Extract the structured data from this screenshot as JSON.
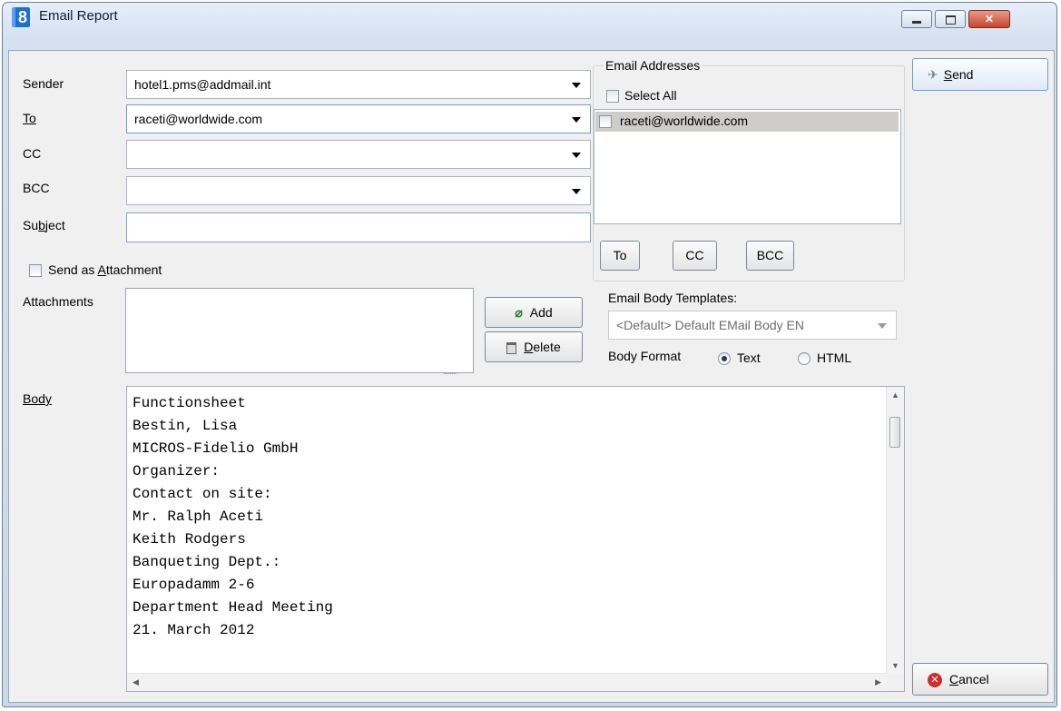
{
  "window": {
    "title": "Email Report",
    "app_icon": "8"
  },
  "form": {
    "sender_label": "Sender",
    "sender_value": "hotel1.pms@addmail.int",
    "to_label": "To",
    "to_value": "raceti@worldwide.com",
    "cc_label": "CC",
    "cc_value": "",
    "bcc_label": "BCC",
    "bcc_value": "",
    "subject_label_pre": "Su",
    "subject_label_u": "b",
    "subject_label_post": "ject",
    "subject_value": "",
    "send_as_attachment_pre": "Send as ",
    "send_as_attachment_u": "A",
    "send_as_attachment_post": "ttachment",
    "attachments_label": "Attachments",
    "add_label": "Add",
    "delete_label_u": "D",
    "delete_label_post": "elete",
    "body_label": "Body"
  },
  "email_addresses": {
    "group_label": "Email Addresses",
    "select_all_label": "Select All",
    "items": [
      {
        "label": "raceti@worldwide.com"
      }
    ],
    "to_btn": "To",
    "cc_btn": "CC",
    "bcc_btn": "BCC"
  },
  "templates": {
    "label": "Email Body Templates:",
    "selected": "<Default> Default EMail Body EN",
    "body_format_label": "Body Format",
    "format_text": "Text",
    "format_html": "HTML",
    "selected_format": "Text"
  },
  "body_lines": [
    "Functionsheet",
    "Bestin, Lisa",
    "MICROS-Fidelio GmbH",
    "Organizer:",
    "Contact on site:",
    "Mr. Ralph Aceti",
    "Keith Rodgers",
    "Banqueting Dept.:",
    "Europadamm 2-6",
    "Department Head Meeting",
    "21. March 2012"
  ],
  "actions": {
    "send_u": "S",
    "send_post": "end",
    "cancel_u": "C",
    "cancel_post": "ancel"
  },
  "splitter_grip": "........",
  "icons": {
    "send": "paper-plane-icon",
    "add": "paperclip-icon",
    "delete": "trash-icon",
    "cancel": "cancel-icon"
  },
  "colors": {
    "title_gradient_top": "#e6eef9",
    "close_button": "#c8452d",
    "selected_item_bg": "#cfcdc9"
  }
}
